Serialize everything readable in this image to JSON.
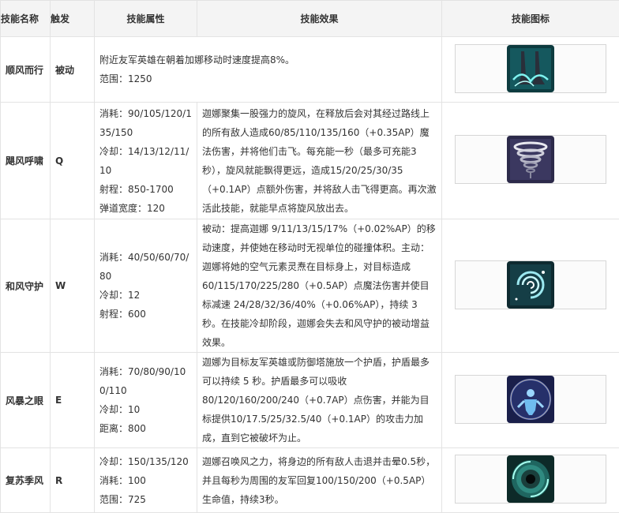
{
  "headers": {
    "name": "技能名称",
    "trigger": "触发",
    "attributes": "技能属性",
    "effect": "技能效果",
    "icon": "技能图标"
  },
  "skills": [
    {
      "name": "顺风而行",
      "trigger": "被动",
      "lines": [
        "附近友军英雄在朝着加娜移动时速度提高8%。",
        "范围：1250"
      ],
      "icon": "tailwind-feet-icon"
    },
    {
      "name": "飓风呼啸",
      "trigger": "Q",
      "attributes": [
        "消耗：90/105/120/135/150",
        "冷却：14/13/12/11/10",
        "射程：850-1700",
        "弹道宽度：120"
      ],
      "effect": "迦娜聚集一股强力的旋风，在释放后会对其经过路线上的所有敌人造成60/85/110/135/160（+0.35AP）魔法伤害，并将他们击飞。每充能一秒（最多可充能3秒），旋风就能飘得更远，造成15/20/25/30/35（+0.1AP）点额外伤害，并将敌人击飞得更高。再次激活此技能，就能早点将旋风放出去。",
      "icon": "tornado-icon"
    },
    {
      "name": "和风守护",
      "trigger": "W",
      "attributes": [
        "消耗：40/50/60/70/80",
        "冷却：12",
        "射程：600"
      ],
      "effect": "被动：提高迦娜 9/11/13/15/17%（+0.02%AP）的移动速度，并使她在移动时无视单位的碰撞体积。主动：迦娜将她的空气元素灵焘在目标身上，对目标造成 60/115/170/225/280（+0.5AP）点魔法伤害并使目标减速 24/28/32/36/40%（+0.06%AP），持续 3 秒。在技能冷却阶段，迦娜会失去和风守护的被动增益效果。",
      "icon": "zephyr-swirl-icon"
    },
    {
      "name": "风暴之眼",
      "trigger": "E",
      "attributes": [
        "消耗：70/80/90/100/110",
        "冷却：10",
        "距离：800"
      ],
      "effect": "迦娜为目标友军英雄或防御塔施放一个护盾，护盾最多可以持续 5 秒。护盾最多可以吸收 80/120/160/200/240（+0.7AP）点伤害，并能为目标提供10/17.5/25/32.5/40（+0.1AP）的攻击力加成，直到它被破坏为止。",
      "icon": "storm-eye-icon"
    },
    {
      "name": "复苏季风",
      "trigger": "R",
      "attributes": [
        "冷却：150/135/120",
        "消耗：100",
        "范围：725"
      ],
      "effect": "迦娜召唤风之力，将身边的所有敌人击退并击晕0.5秒，并且每秒为周围的友军回复100/150/200（+0.5AP）生命值，持续3秒。",
      "icon": "monsoon-vortex-icon"
    }
  ],
  "colors": {
    "header_bg": "#f4f4f4",
    "border": "#e3e3e3",
    "text": "#333333"
  }
}
